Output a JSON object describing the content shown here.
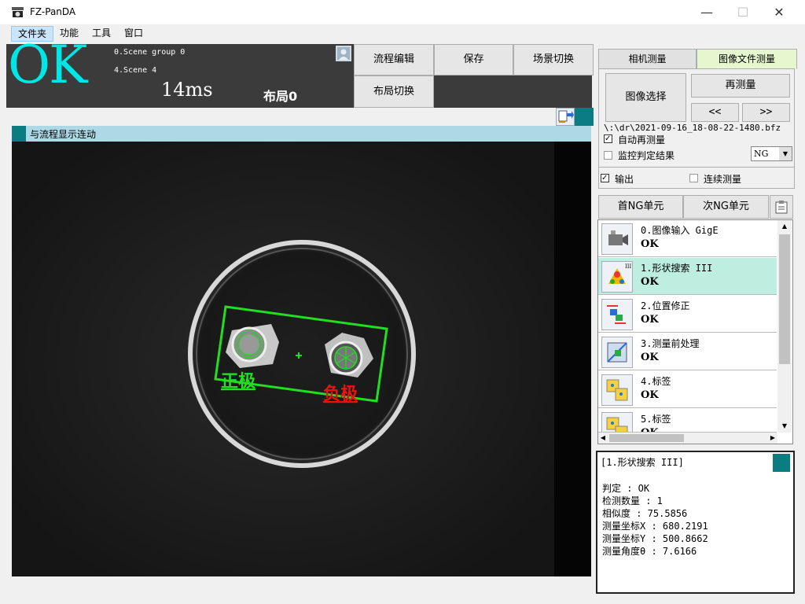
{
  "window": {
    "title": "FZ-PanDA",
    "minimize": "—",
    "maximize": "☐",
    "close": "✕"
  },
  "menu": [
    "文件夹",
    "功能",
    "工具",
    "窗口"
  ],
  "status": {
    "result": "OK",
    "scene_group": "0.Scene group 0",
    "scene": "4.Scene 4",
    "time": "14ms",
    "layout": "布局0"
  },
  "toolbar": {
    "flow_edit": "流程编辑",
    "save": "保存",
    "scene_switch": "场景切换",
    "layout_switch": "布局切换"
  },
  "image_panel": {
    "header": "与流程显示连动",
    "label_positive": "正极",
    "label_negative": "负极"
  },
  "tabs": {
    "camera": "相机测量",
    "image_file": "图像文件测量"
  },
  "file_panel": {
    "image_select": "图像选择",
    "remeasure": "再测量",
    "prev": "<<",
    "next": ">>",
    "file_path": "\\:\\dr\\2021-09-16_18-08-22-1480.bfz",
    "auto_remeasure": "自动再测量",
    "monitor_result": "监控判定结果",
    "ng_select": "NG"
  },
  "output": {
    "output_label": "输出",
    "continuous_label": "连续测量"
  },
  "ng_nav": {
    "first": "首NG单元",
    "next": "次NG单元"
  },
  "flow_items": [
    {
      "name": "0.图像输入 GigE",
      "result": "OK",
      "icon": "camera-input-icon"
    },
    {
      "name": "1.形状搜索 III",
      "result": "OK",
      "icon": "shape-search-icon"
    },
    {
      "name": "2.位置修正",
      "result": "OK",
      "icon": "position-correction-icon"
    },
    {
      "name": "3.测量前处理",
      "result": "OK",
      "icon": "preprocess-icon"
    },
    {
      "name": "4.标签",
      "result": "OK",
      "icon": "label-icon"
    },
    {
      "name": "5.标签",
      "result": "OK",
      "icon": "label-icon"
    }
  ],
  "detail": {
    "title": "[1.形状搜索 III]",
    "lines": [
      "判定 : OK",
      "检测数量 : 1",
      "相似度 : 75.5856",
      "测量坐标X : 680.2191",
      "测量坐标Y : 500.8662",
      "测量角度θ : 7.6166"
    ]
  },
  "colors": {
    "ok_cyan": "#00e5e5",
    "teal": "#0a7c82",
    "header_blue": "#add8e6",
    "select_green": "#bdeee0",
    "detect_green": "#22dd22",
    "label_red": "#ee1111"
  }
}
